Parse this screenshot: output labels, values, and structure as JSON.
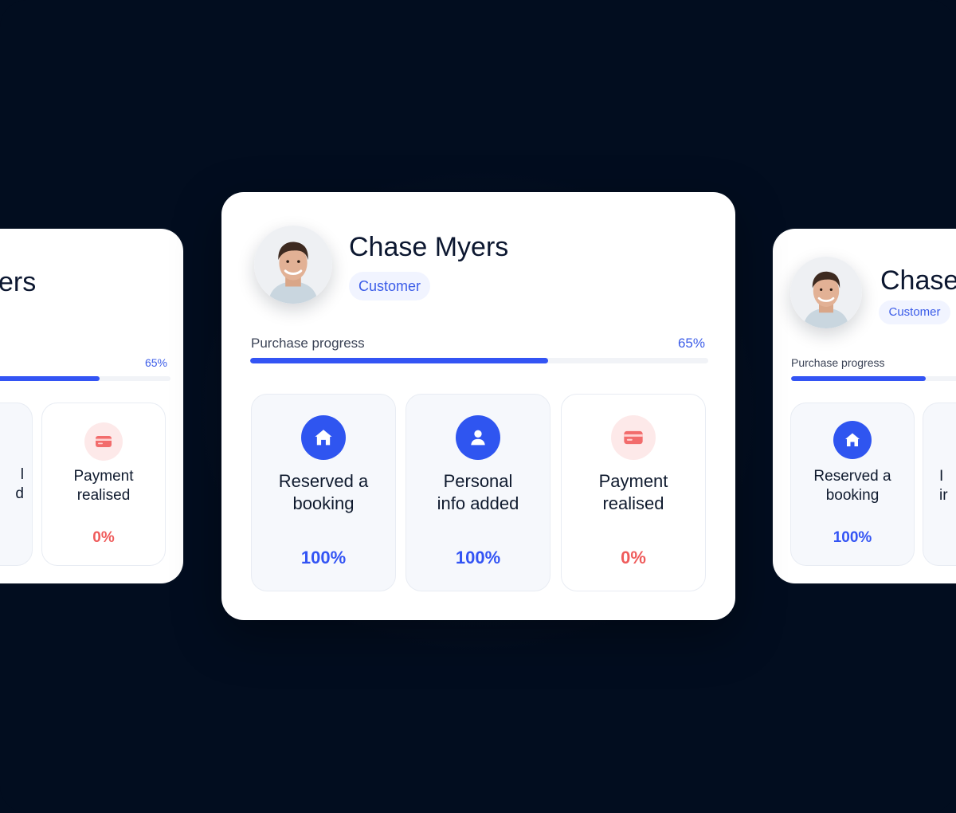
{
  "main_card": {
    "name": "Chase Myers",
    "role": "Customer",
    "progress_label": "Purchase progress",
    "progress_text": "65%",
    "progress_value": 0.65,
    "steps": [
      {
        "icon": "home-icon",
        "label": "Reserved a\nbooking",
        "value": "100%"
      },
      {
        "icon": "user-icon",
        "label": "Personal\ninfo added",
        "value": "100%"
      },
      {
        "icon": "credit-card-icon",
        "label": "Payment\nrealised",
        "value": "0%"
      }
    ]
  },
  "left_card": {
    "name_fragment": "ers",
    "progress_text": "65%",
    "progress_value": 0.65,
    "steps": [
      {
        "label": "l\nd"
      },
      {
        "icon": "credit-card-icon",
        "label": "Payment\nrealised",
        "value": "0%"
      }
    ]
  },
  "right_card": {
    "name_fragment": "Chase",
    "role": "Customer",
    "progress_label": "Purchase progress",
    "progress_value": 0.65,
    "steps": [
      {
        "icon": "home-icon",
        "label": "Reserved a\nbooking",
        "value": "100%"
      },
      {
        "label": "I\nir"
      }
    ]
  },
  "colors": {
    "background": "#020d1f",
    "accent_blue": "#3354f4",
    "alert_red": "#ef5b5b",
    "badge_bg": "#f1f4ff"
  }
}
